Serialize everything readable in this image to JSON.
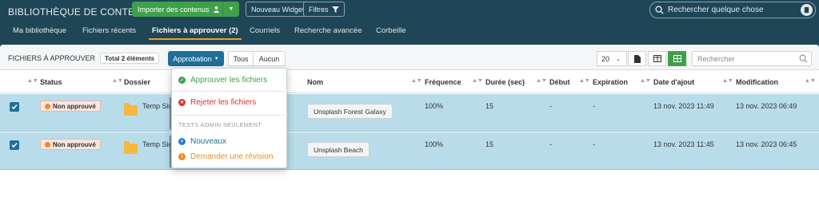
{
  "topbar": {
    "title": "BIBLIOTHÈQUE DE CONTENUS",
    "import_label": "Importer des contenus",
    "widget_label": "Nouveau Widget",
    "filters_label": "Filtres",
    "search_placeholder": "Rechercher quelque chose"
  },
  "nav": {
    "tabs": [
      {
        "label": "Ma bibliothèque"
      },
      {
        "label": "Fichiers récents"
      },
      {
        "label": "Fichiers à approuver (2)"
      },
      {
        "label": "Courriels"
      },
      {
        "label": "Recherche avancée"
      },
      {
        "label": "Corbeille"
      }
    ]
  },
  "toolbar": {
    "title": "FICHIERS À APPROUVER",
    "count": "Total 2 éléments",
    "approbation_label": "Approbation",
    "all_label": "Tous",
    "none_label": "Aucun",
    "page_size": "20",
    "search_placeholder": "Rechercher"
  },
  "table": {
    "headers": {
      "status": "Status",
      "folder": "Dossier",
      "name": "Nom",
      "frequency": "Fréquence",
      "duration": "Durée (sec)",
      "start": "Début",
      "expiration": "Expiration",
      "date_added": "Date d'ajout",
      "modification": "Modification"
    },
    "rows": [
      {
        "status": "Non approuvé",
        "folder": "Temp Sid",
        "name": "Unsplash Forest Galaxy",
        "frequency": "100%",
        "duration": "15",
        "start": "-",
        "expiration": "-",
        "date_added": "13 nov. 2023 11:49",
        "modification": "13 nov. 2023 06:49"
      },
      {
        "status": "Non approuvé",
        "folder": "Temp Sid",
        "name": "Unsplash Beach",
        "frequency": "100%",
        "duration": "15",
        "start": "-",
        "expiration": "-",
        "date_added": "13 nov. 2023 11:45",
        "modification": "13 nov. 2023 06:45"
      }
    ]
  },
  "dropdown": {
    "approve": "Approuver les fichiers",
    "reject": "Rejeter les fichiers",
    "section_header": "TESTS ADMIN SEULEMENT",
    "new": "Nouveaux",
    "request_review": "Demander une révision"
  },
  "colors": {
    "header_bg": "#1f4656",
    "green": "#3ea14a",
    "blue": "#1f6f99",
    "row_selected": "#b9dcea",
    "reject_red": "#d9322b",
    "review_orange": "#f08a24"
  }
}
